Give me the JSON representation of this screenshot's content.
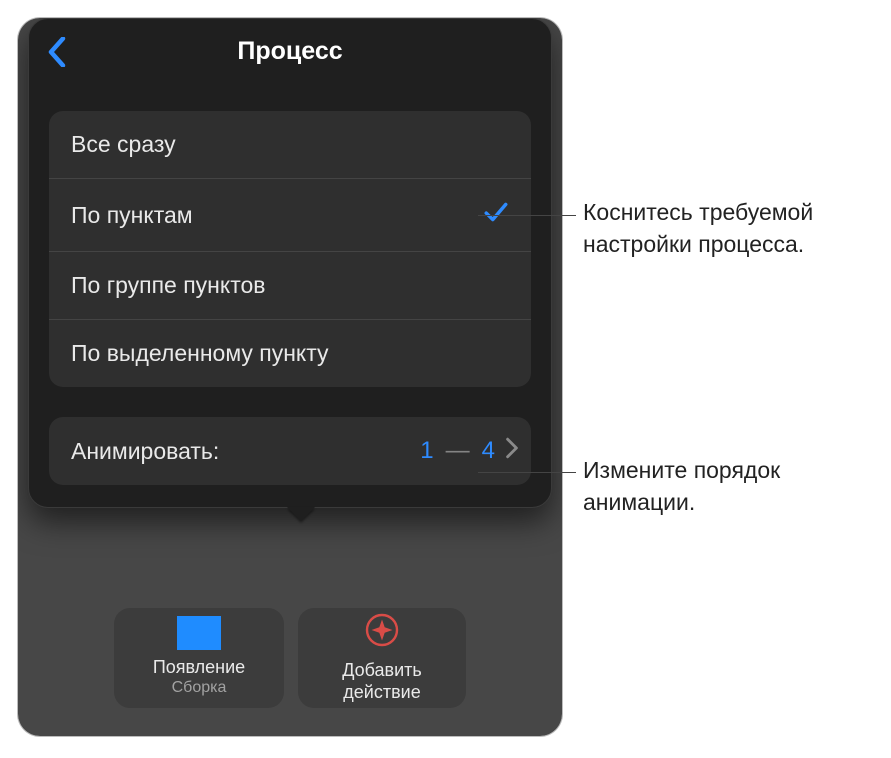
{
  "popover": {
    "title": "Процесс",
    "options": [
      {
        "label": "Все сразу",
        "checked": false
      },
      {
        "label": "По пунктам",
        "checked": true
      },
      {
        "label": "По группе пунктов",
        "checked": false
      },
      {
        "label": "По выделенному пункту",
        "checked": false
      }
    ],
    "animate": {
      "label": "Анимировать:",
      "from": "1",
      "to": "4",
      "dash": "—"
    }
  },
  "bottom": {
    "appear": {
      "title": "Появление",
      "sub": "Сборка"
    },
    "add": {
      "line1": "Добавить",
      "line2": "действие"
    }
  },
  "callouts": {
    "c1": "Коснитесь требуемой настройки процесса.",
    "c2": "Измените порядок анимации."
  }
}
